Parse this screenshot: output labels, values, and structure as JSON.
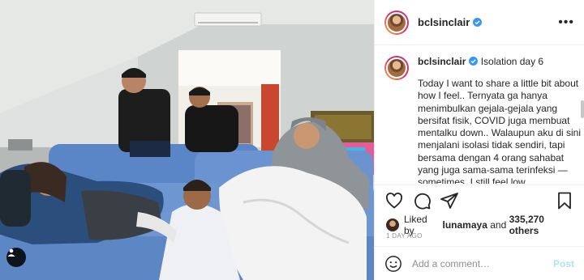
{
  "post": {
    "username": "bclsinclair",
    "verified": true,
    "caption": {
      "username": "bclsinclair",
      "first_line": "Isolation day 6",
      "body": "Today I want to share a little bit about how I feel.. Ternyata ga hanya menimbulkan gejala-gejala yang bersifat fisik, COVID juga membuat mentalku down.. Walaupun aku di sini menjalani isolasi tidak sendiri, tapi bersama dengan 4 orang sahabat yang juga sama-sama terinfeksi — sometimes, I still feel low.."
    },
    "likes": {
      "prefix": "Liked by",
      "first_user": "lunamaya",
      "connector": "and",
      "others": "335,270 others"
    },
    "timestamp": "1 day ago"
  },
  "comment_box": {
    "placeholder": "Add a comment…",
    "post_label": "Post"
  },
  "icons": {
    "like": "heart-icon",
    "comment": "comment-icon",
    "share": "paper-plane-icon",
    "save": "bookmark-icon",
    "more": "more-icon",
    "emoji": "emoji-icon",
    "tag": "user-tag-icon",
    "verified": "verified-badge-icon"
  },
  "colors": {
    "verified": "#3897f0",
    "post_button_disabled": "#b2dffc",
    "muted_text": "#8e8e8e",
    "divider": "#efefef"
  }
}
